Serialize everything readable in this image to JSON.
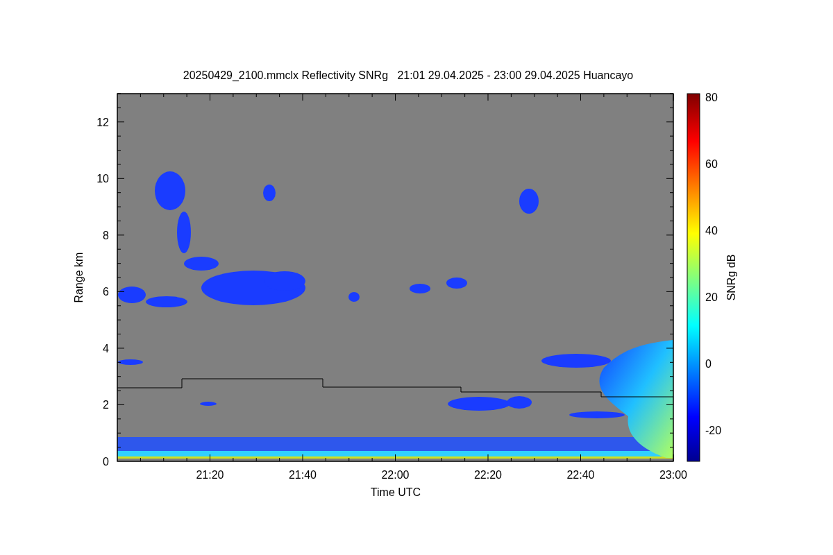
{
  "title": "20250429_2100.mmclx Reflectivity SNRg   21:01 29.04.2025 - 23:00 29.04.2025 Huancayo",
  "xlabel": "Time UTC",
  "ylabel": "Range km",
  "xticks": [
    "21:20",
    "21:40",
    "22:00",
    "22:20",
    "22:40",
    "23:00"
  ],
  "yticks": [
    "12",
    "10",
    "8",
    "6",
    "4",
    "2",
    "0"
  ],
  "colorbar": {
    "label": "SNRg dB",
    "ticks": [
      "80",
      "60",
      "40",
      "20",
      "0",
      "-20"
    ]
  }
}
